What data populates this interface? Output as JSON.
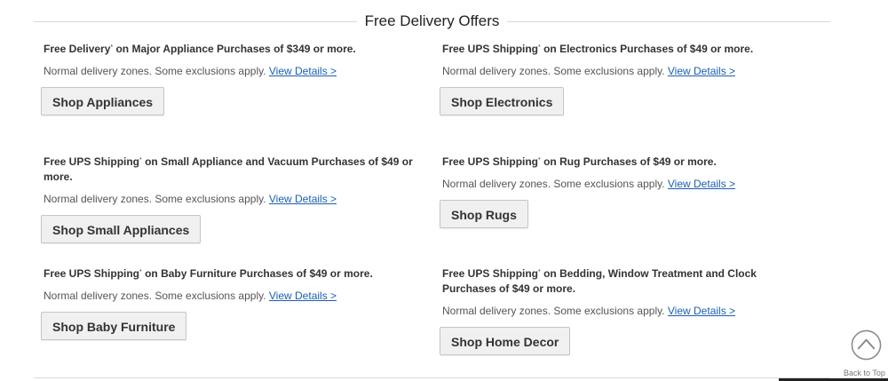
{
  "section": {
    "title": "Free Delivery Offers"
  },
  "offers": [
    {
      "prefix": "Free Delivery",
      "mark": "*",
      "suffix": " on Major Appliance Purchases of $349 or more.",
      "note": "Normal delivery zones. Some exclusions apply. ",
      "link": "View Details >",
      "button": "Shop Appliances"
    },
    {
      "prefix": "Free UPS Shipping",
      "mark": "*",
      "suffix": " on Electronics Purchases of $49 or more.",
      "note": "Normal delivery zones. Some exclusions apply. ",
      "link": "View Details >",
      "button": "Shop Electronics"
    },
    {
      "prefix": "Free UPS Shipping",
      "mark": "*",
      "suffix": " on Small Appliance and Vacuum Purchases of $49 or more.",
      "note": "Normal delivery zones. Some exclusions apply. ",
      "link": "View Details >",
      "button": "Shop Small Appliances"
    },
    {
      "prefix": "Free UPS Shipping",
      "mark": "*",
      "suffix": " on Rug Purchases of $49 or more.",
      "note": "Normal delivery zones. Some exclusions apply. ",
      "link": "View Details >",
      "button": "Shop Rugs"
    },
    {
      "prefix": "Free UPS Shipping",
      "mark": "*",
      "suffix": " on Baby Furniture Purchases of $49 or more.",
      "note": "Normal delivery zones. Some exclusions apply. ",
      "link": "View Details >",
      "button": "Shop Baby Furniture"
    },
    {
      "prefix": "Free UPS Shipping",
      "mark": "*",
      "suffix": " on Bedding, Window Treatment and Clock Purchases of $49 or more.",
      "note": "Normal delivery zones. Some exclusions apply. ",
      "link": "View Details >",
      "button": "Shop Home Decor"
    }
  ],
  "back_to_top": {
    "label": "Back to Top",
    "icon": "chevron-up-circle-icon"
  },
  "colors": {
    "link": "#1a5fb4",
    "button_bg": "#f0f0f0",
    "divider": "#d9d9d9"
  }
}
